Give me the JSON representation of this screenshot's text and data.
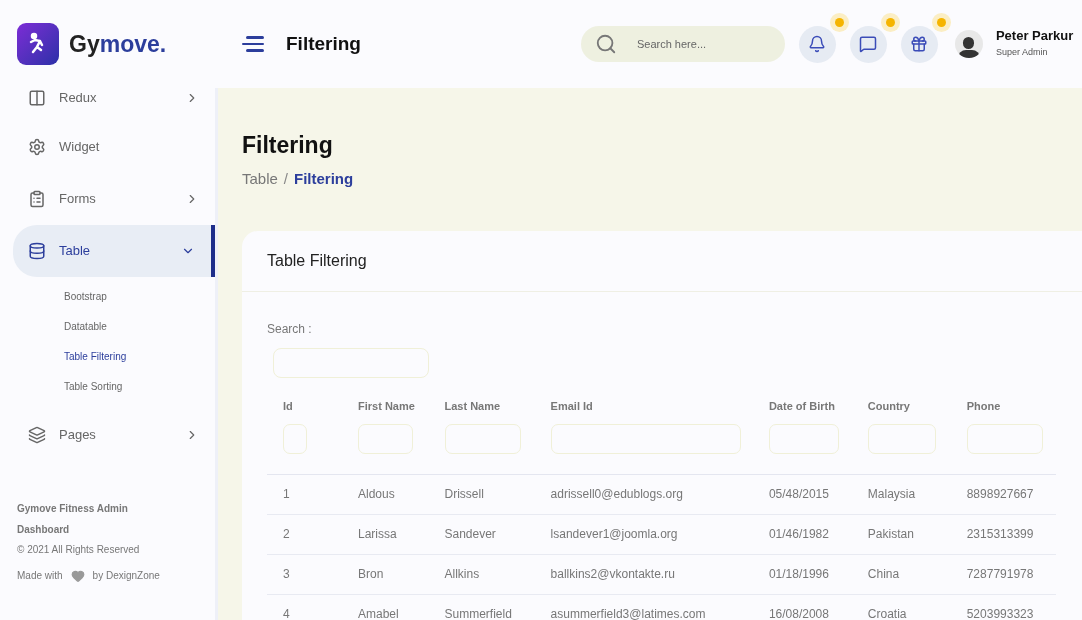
{
  "brand": {
    "name_dark": "Gy",
    "name_accent": "move."
  },
  "header": {
    "title": "Filtering",
    "search": {
      "placeholder": "Search here..."
    },
    "icon_buttons": [
      {
        "kind": "bell",
        "badge": true
      },
      {
        "kind": "message",
        "badge": true
      },
      {
        "kind": "gift",
        "badge": true
      }
    ],
    "user": {
      "name": "Peter Parkur",
      "role": "Super Admin"
    }
  },
  "sidebar": {
    "items": [
      {
        "label": "Redux",
        "kind": "redux",
        "selected": false,
        "expanded": false,
        "has_arrow": true
      },
      {
        "label": "Widget",
        "kind": "widget",
        "selected": false,
        "has_arrow": false
      },
      {
        "label": "Forms",
        "kind": "forms",
        "selected": false,
        "expanded": false,
        "has_arrow": true
      },
      {
        "label": "Table",
        "kind": "table",
        "selected": true,
        "expanded": true,
        "has_arrow": true,
        "children": [
          {
            "label": "Bootstrap",
            "selected": false
          },
          {
            "label": "Datatable",
            "selected": false
          },
          {
            "label": "Table Filtering",
            "selected": true
          },
          {
            "label": "Table Sorting",
            "selected": false
          }
        ]
      },
      {
        "label": "Pages",
        "kind": "pages",
        "selected": false,
        "expanded": false,
        "has_arrow": true
      }
    ],
    "footer": {
      "title": "Gymove Fitness Admin Dashboard",
      "copyright": "© 2021 All Rights Reserved",
      "made_with": "Made with",
      "by": "by DexignZone"
    }
  },
  "page": {
    "title": "Filtering",
    "breadcrumb": [
      {
        "label": "Table",
        "selected": false
      },
      {
        "label": "Filtering",
        "selected": true
      }
    ],
    "separator": "/"
  },
  "card": {
    "title": "Table Filtering",
    "search_label": "Search :",
    "table": {
      "columns": [
        {
          "label": "Id"
        },
        {
          "label": "First Name"
        },
        {
          "label": "Last Name"
        },
        {
          "label": "Email Id"
        },
        {
          "label": "Date of Birth"
        },
        {
          "label": "Country"
        },
        {
          "label": "Phone"
        }
      ],
      "rows": [
        [
          "1",
          "Aldous",
          "Drissell",
          "adrissell0@edublogs.org",
          "05/48/2015",
          "Malaysia",
          "8898927667"
        ],
        [
          "2",
          "Larissa",
          "Sandever",
          "lsandever1@joomla.org",
          "01/46/1982",
          "Pakistan",
          "2315313399"
        ],
        [
          "3",
          "Bron",
          "Allkins",
          "ballkins2@vkontakte.ru",
          "01/18/1996",
          "China",
          "7287791978"
        ],
        [
          "4",
          "Amabel",
          "Summerfield",
          "asummerfield3@latimes.com",
          "16/08/2008",
          "Croatia",
          "5203993323"
        ]
      ]
    }
  }
}
